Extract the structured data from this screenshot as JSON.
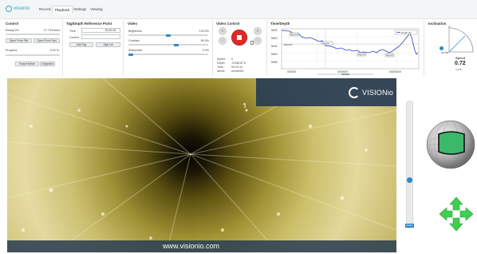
{
  "app": {
    "brand": "visionio"
  },
  "tabs": [
    {
      "label": "Record"
    },
    {
      "label": "Playback"
    },
    {
      "label": "Settings"
    },
    {
      "label": "Viewlog"
    }
  ],
  "control": {
    "title": "Control",
    "ready_label": "Ready 0%",
    "lines_label": "17.7/29 lines",
    "open_from_file": "Open From File",
    "open_from_tool": "Open From Tool",
    "progress_label": "Progress",
    "progress_value": "0.00 %",
    "progress_fraction": 0.0,
    "export_movie": "Export Movie",
    "snapshot": "Snapshot"
  },
  "tag": {
    "title": "Tag/Depth Reference Point",
    "time_label": "Time",
    "time_value": "00:20:15",
    "correct_label": "Correct",
    "add_tag": "Add Tag",
    "sign_ud": "Sign Ud"
  },
  "video_settings": {
    "title": "Video",
    "brightness_label": "Brightness",
    "brightness_value": "100.0%",
    "contrast_label": "Contrast",
    "contrast_value": "80.0%",
    "sharpness_label": "Sharpness",
    "sharpness_value": "0.0%"
  },
  "video_control": {
    "title": "Video Control",
    "speed_label": "Speed",
    "speed_value": "0",
    "depth_label": "Depth",
    "depth_value": "-9,636.87 ft",
    "time_label": "Time",
    "time_value": "00:20:15",
    "movie_label": "Movie",
    "movie_value": "movie001"
  },
  "time_depth": {
    "title": "Time/Depth",
    "legend": "Depth (ft)",
    "y_ticks": [
      "-9600",
      "-9620",
      "-9640",
      "-9660",
      "-9680"
    ],
    "x_ticks": [
      "000000",
      "0000000",
      "00000000"
    ],
    "marker_value": "-9626.87",
    "tags": [
      "Tag text",
      "Tag text",
      "Tag text",
      "Tag text"
    ]
  },
  "inclination": {
    "title": "Inclination",
    "top_value": "0°",
    "left_value": "45.000°",
    "speed_label": "Speed",
    "speed_value": "0.72",
    "speed_unit": "m/min"
  },
  "overlay": {
    "watermark_brand": "VISIONio",
    "footer_url": "www.visionio.com"
  },
  "side": {
    "badge": "RESET"
  },
  "colors": {
    "accent": "#2a88c8",
    "brand": "#2aa6c9",
    "overlay_bar": "#273c52",
    "gauge_green": "#3bb86a",
    "arrow_green": "#3fce52",
    "record_red": "#e02828"
  }
}
